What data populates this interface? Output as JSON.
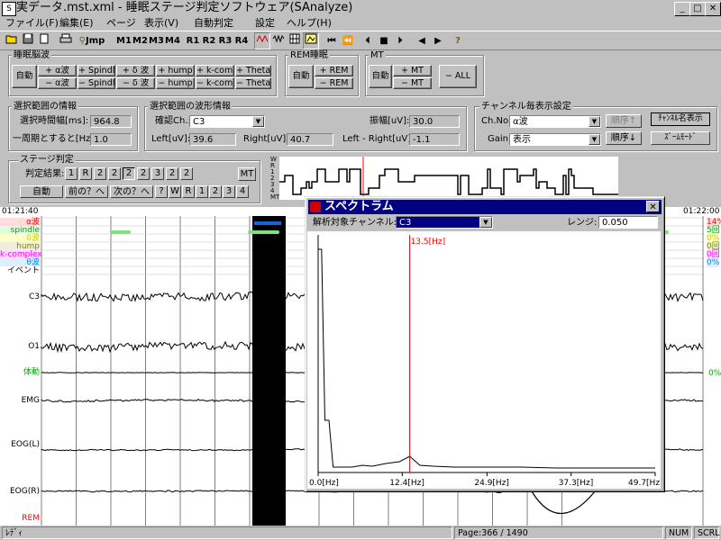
{
  "window": {
    "title": "実データ.mst.xml - 睡眠ステージ判定ソフトウェア(SAnalyze)",
    "min": "_",
    "max": "□",
    "close": "✕"
  },
  "menu": [
    "ファイル(F)",
    "編集(E)",
    "ページ",
    "表示(V)",
    "自動判定",
    "設定",
    "ヘルプ(H)"
  ],
  "toolbar": {
    "jump": "Jmp",
    "marks": [
      "M1",
      "M2",
      "M3",
      "M4",
      "R1",
      "R2",
      "R3",
      "R4"
    ],
    "help": "?"
  },
  "sleep_wave": {
    "title": "睡眠脳波",
    "auto": "自動",
    "plus": [
      "+ α波",
      "+ Spindle",
      "+ δ 波",
      "+ hump",
      "+ k-comp.",
      "+ Theta"
    ],
    "minus": [
      "− α波",
      "− Spindle",
      "− δ 波",
      "− hump",
      "− k-comp.",
      "− Theta"
    ]
  },
  "rem": {
    "title": "REM睡眠",
    "auto": "自動",
    "plus": "+ REM",
    "minus": "− REM"
  },
  "mt": {
    "title": "MT",
    "auto": "自動",
    "plus": "+ MT",
    "minus": "− MT",
    "all": "− ALL"
  },
  "range_info": {
    "title": "選択範囲の情報",
    "interval_label": "選択時間幅[ms]:",
    "interval_value": "964.8",
    "freq_label": "一周期とすると[Hz]:",
    "freq_value": "1.0"
  },
  "waveform_info": {
    "title": "選択範囲の波形情報",
    "ch_label": "確認Ch.:",
    "ch_value": "C3",
    "amp_label": "振幅[uV]:",
    "amp_value": "30.0",
    "left_label": "Left[uV]:",
    "left_value": "39.6",
    "right_label": "Right[uV]:",
    "right_value": "40.7",
    "diff_label": "Left - Right[uV]:",
    "diff_value": "-1.1"
  },
  "channel_settings": {
    "title": "チャンネル毎表示設定",
    "ch_label": "Ch.No.:",
    "ch_value": "α波",
    "gain_label": "Gain:",
    "gain_value": "表示",
    "order_up": "順序↑",
    "order_down": "順序↓",
    "show_names": "ﾁｬﾝﾈﾙ名表示",
    "zoom_mode": "ｽﾞｰﾑﾓｰﾄﾞ"
  },
  "stage": {
    "title": "ステージ判定",
    "result_label": "判定結果:",
    "results": [
      "1",
      "R",
      "2",
      "2",
      "2",
      "2",
      "3",
      "2",
      "2"
    ],
    "mt_btn": "MT",
    "auto": "自動",
    "prev": "前の？へ",
    "next": "次の？へ",
    "choices": [
      "?",
      "W",
      "R",
      "1",
      "2",
      "3",
      "4"
    ],
    "hypno_labels": [
      "W",
      "R",
      "1",
      "2",
      "3",
      "4",
      "MT"
    ]
  },
  "chart": {
    "time_left": "01:21:40",
    "time_right": "01:22:00",
    "event_labels": [
      "α波",
      "spindle",
      "δ波",
      "hump",
      "k-complex",
      "θ波",
      "イベント"
    ],
    "event_values": [
      "14%",
      "5回",
      "0%",
      "0回",
      "0回",
      "0%"
    ],
    "channels": [
      "C3",
      "O1",
      "体動",
      "EMG",
      "EOG(L)",
      "EOG(R)",
      "REM"
    ],
    "body_pct": "0%"
  },
  "status": {
    "left": "ﾚﾃﾞｨ",
    "page": "Page:366 / 1490",
    "num": "NUM",
    "scrl": "SCRL"
  },
  "dialog": {
    "title": "スペクトラム",
    "channel_label": "解析対象チャンネル:",
    "channel_value": "C3",
    "range_label": "レンジ:",
    "range_value": "0.050",
    "close": "✕",
    "peak_label": "13.5[Hz]",
    "x_ticks": [
      "0.0[Hz]",
      "12.4[Hz]",
      "24.9[Hz]",
      "37.3[Hz]",
      "49.7[Hz]"
    ]
  },
  "colors": {
    "title_bar": "#000080",
    "event_red": "#ff0000",
    "spindle_green": "#00aa00",
    "peak_line": "#ff0000",
    "selection": "#000000"
  }
}
